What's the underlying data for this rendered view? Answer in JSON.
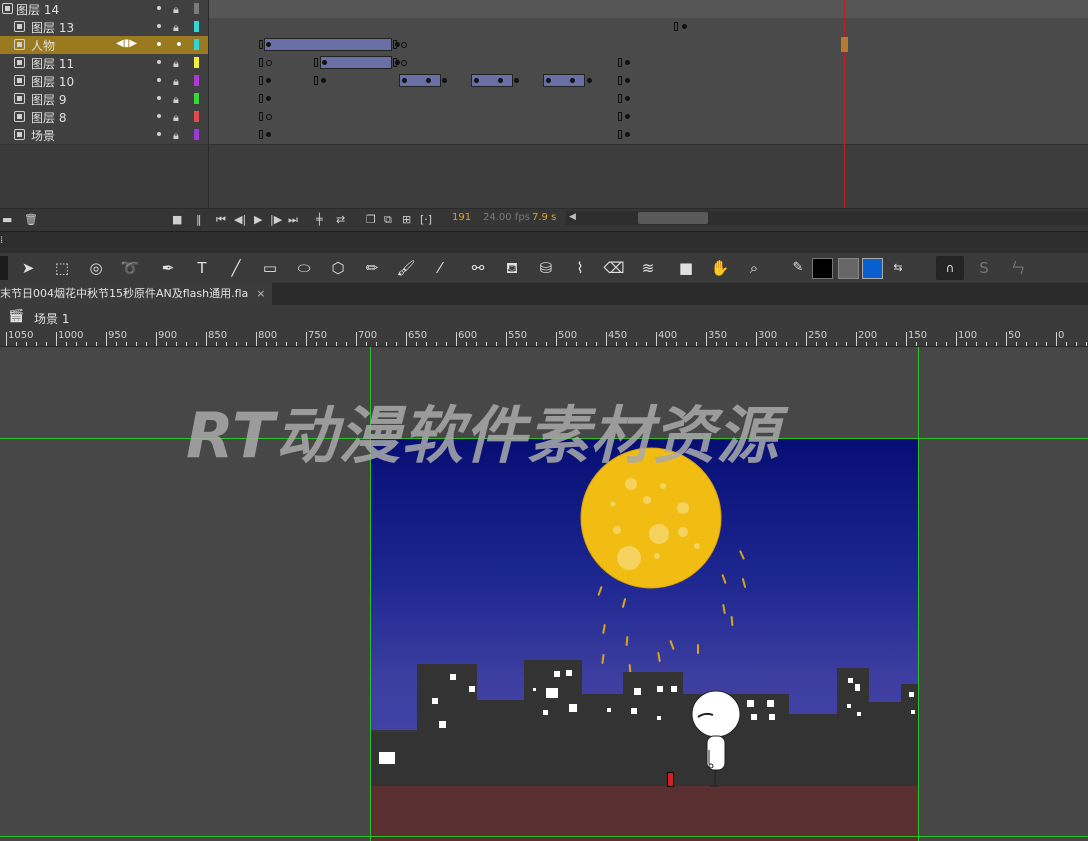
{
  "layers": [
    {
      "name": "图层 14",
      "color": "#7a7a7a",
      "selected": false
    },
    {
      "name": "图层 13",
      "color": "#33d6d6",
      "selected": false
    },
    {
      "name": "人物",
      "color": "#33d6d6",
      "selected": true
    },
    {
      "name": "图层 11",
      "color": "#f2f23a",
      "selected": false
    },
    {
      "name": "图层 10",
      "color": "#b13ad6",
      "selected": false
    },
    {
      "name": "图层 9",
      "color": "#3ad63a",
      "selected": false
    },
    {
      "name": "图层 8",
      "color": "#e04a4a",
      "selected": false
    },
    {
      "name": "场景",
      "color": "#9b3ad6",
      "selected": false
    }
  ],
  "timeline_status": {
    "current_frame": "191",
    "fps": "24.00 fps",
    "elapsed": "7.9 s"
  },
  "document": {
    "tab_title": "末节日004烟花中秋节15秒原件AN及flash通用.fla",
    "close_glyph": "×"
  },
  "scene": {
    "label": "场景 1"
  },
  "ruler": {
    "labels": [
      "1050",
      "1000",
      "950",
      "900",
      "850",
      "800",
      "750",
      "700",
      "650",
      "600",
      "550",
      "500",
      "450",
      "400",
      "350",
      "300",
      "250",
      "200",
      "150",
      "100",
      "50",
      "0"
    ]
  },
  "watermark": "RT动漫软件素材资源",
  "icons": {
    "tools": [
      "selection-icon",
      "free-transform-icon",
      "3d-rotation-icon",
      "lasso-icon",
      "pen-icon",
      "text-icon",
      "line-icon",
      "rectangle-icon",
      "oval-icon",
      "polystar-icon",
      "pencil-icon",
      "paint-brush-icon",
      "brush-icon",
      "bone-icon",
      "paint-bucket-icon",
      "ink-bottle-icon",
      "eyedropper-icon",
      "eraser-icon",
      "width-icon",
      "camera-icon",
      "hand-icon",
      "zoom-icon"
    ],
    "stroke_color": "#000000",
    "fill_color": "#0a5fd0"
  }
}
